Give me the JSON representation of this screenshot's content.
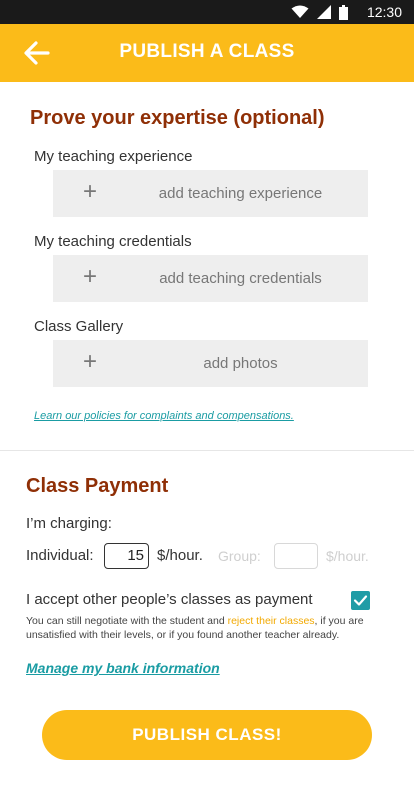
{
  "status_bar": {
    "time": "12:30"
  },
  "app_bar": {
    "title": "PUBLISH A CLASS"
  },
  "expertise": {
    "heading": "Prove your expertise (optional)",
    "experience_label": "My teaching experience",
    "experience_action": "add teaching experience",
    "credentials_label": "My teaching credentials",
    "credentials_action": "add teaching credentials",
    "gallery_label": "Class Gallery",
    "gallery_action": "add photos",
    "plus_glyph": "+",
    "policy_link": "Learn our policies for complaints and compensations."
  },
  "payment": {
    "heading": "Class Payment",
    "charging_label": "I’m charging:",
    "individual_label": "Individual:",
    "individual_value": "15",
    "individual_unit": "$/hour.",
    "group_label": "Group:",
    "group_value": "",
    "group_unit": "$/hour.",
    "accept_label": "I accept other people’s classes as payment",
    "accept_checked": true,
    "note_before": "You can still negotiate with the student and ",
    "note_highlight": "reject their classes",
    "note_after": ", if you are unsatisfied with their levels, or if you found another teacher already.",
    "bank_link": "Manage my bank information"
  },
  "publish_button": "PUBLISH CLASS!",
  "colors": {
    "accent": "#fbbb19",
    "heading": "#8f2f06",
    "link": "#1a9ca3",
    "checkbox": "#1f9ca6",
    "status_bar": "#1a1a1a"
  }
}
